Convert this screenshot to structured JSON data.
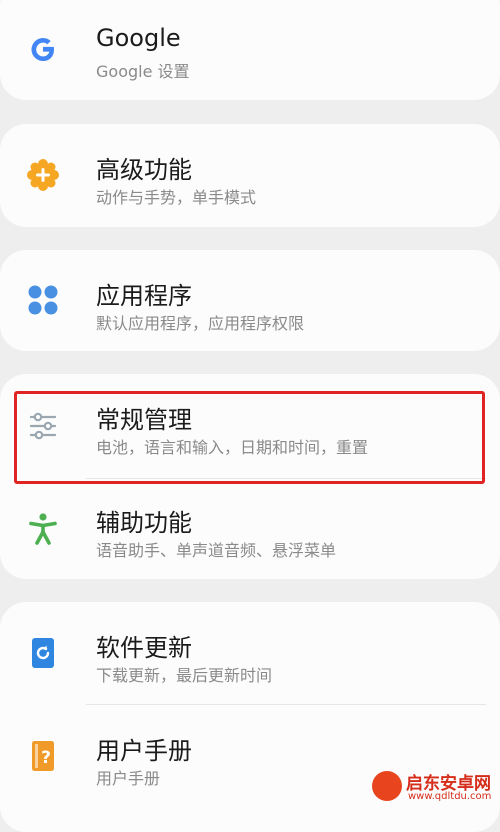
{
  "settings": {
    "items": [
      {
        "title": "Google",
        "subtitle": "Google 设置",
        "icon": "google-icon"
      },
      {
        "title": "高级功能",
        "subtitle": "动作与手势，单手模式",
        "icon": "advanced-features-icon"
      },
      {
        "title": "应用程序",
        "subtitle": "默认应用程序，应用程序权限",
        "icon": "apps-icon"
      },
      {
        "title": "常规管理",
        "subtitle": "电池，语言和输入，日期和时间，重置",
        "icon": "sliders-icon"
      },
      {
        "title": "辅助功能",
        "subtitle": "语音助手、单声道音频、悬浮菜单",
        "icon": "accessibility-icon"
      },
      {
        "title": "软件更新",
        "subtitle": "下载更新，最后更新时间",
        "icon": "software-update-icon"
      },
      {
        "title": "用户手册",
        "subtitle": "用户手册",
        "icon": "user-manual-icon"
      }
    ]
  },
  "colors": {
    "google_blue": "#4285f4",
    "orange": "#f5a623",
    "apps_blue": "#4a90e2",
    "sliders_gray": "#9aa7b0",
    "accessibility_green": "#4caf50",
    "update_blue": "#2f86e0",
    "manual_orange": "#f09a2a",
    "highlight_red": "#e02424"
  },
  "watermark": {
    "line1": "启东安卓网",
    "line2": "www.qdltdu.com"
  }
}
